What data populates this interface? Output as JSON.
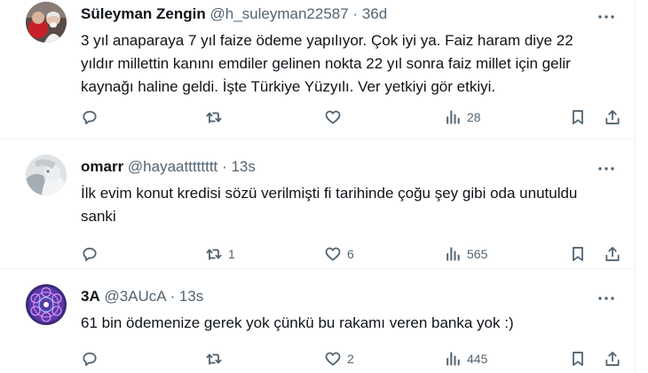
{
  "tweets": [
    {
      "name": "Süleyman Zengin",
      "handle": "@h_suleyman22587",
      "dot": "·",
      "time": "36d",
      "text": "3 yıl anaparaya 7 yıl faize ödeme yapılıyor. Çok iyi ya. Faiz haram diye 22\nyıldır millettin kanını emdiler gelinen nokta 22 yıl sonra faiz millet için gelir\nkaynağı haline geldi. İşte Türkiye Yüzyılı. Ver yetkiyi gör etkiyi.",
      "replies": "",
      "retweets": "",
      "likes": "",
      "views": "28"
    },
    {
      "name": "omarr",
      "handle": "@hayaatttttttt",
      "dot": "·",
      "time": "13s",
      "text": "İlk evim konut kredisi sözü verilmişti fi tarihinde çoğu şey gibi oda unutuldu\nsanki",
      "replies": "",
      "retweets": "1",
      "likes": "6",
      "views": "565"
    },
    {
      "name": "3A",
      "handle": "@3AUcA",
      "dot": "·",
      "time": "13s",
      "text": "61 bin ödemenize gerek yok çünkü bu rakamı veren banka yok :)",
      "replies": "",
      "retweets": "",
      "likes": "2",
      "views": "445"
    }
  ],
  "icons": {
    "reply": "reply-icon",
    "retweet": "retweet-icon",
    "like": "heart-icon",
    "views": "views-icon",
    "bookmark": "bookmark-icon",
    "share": "share-icon",
    "more": "more-icon"
  },
  "colors": {
    "text": "#0f1419",
    "secondary": "#536471",
    "divider": "#eff3f4"
  }
}
